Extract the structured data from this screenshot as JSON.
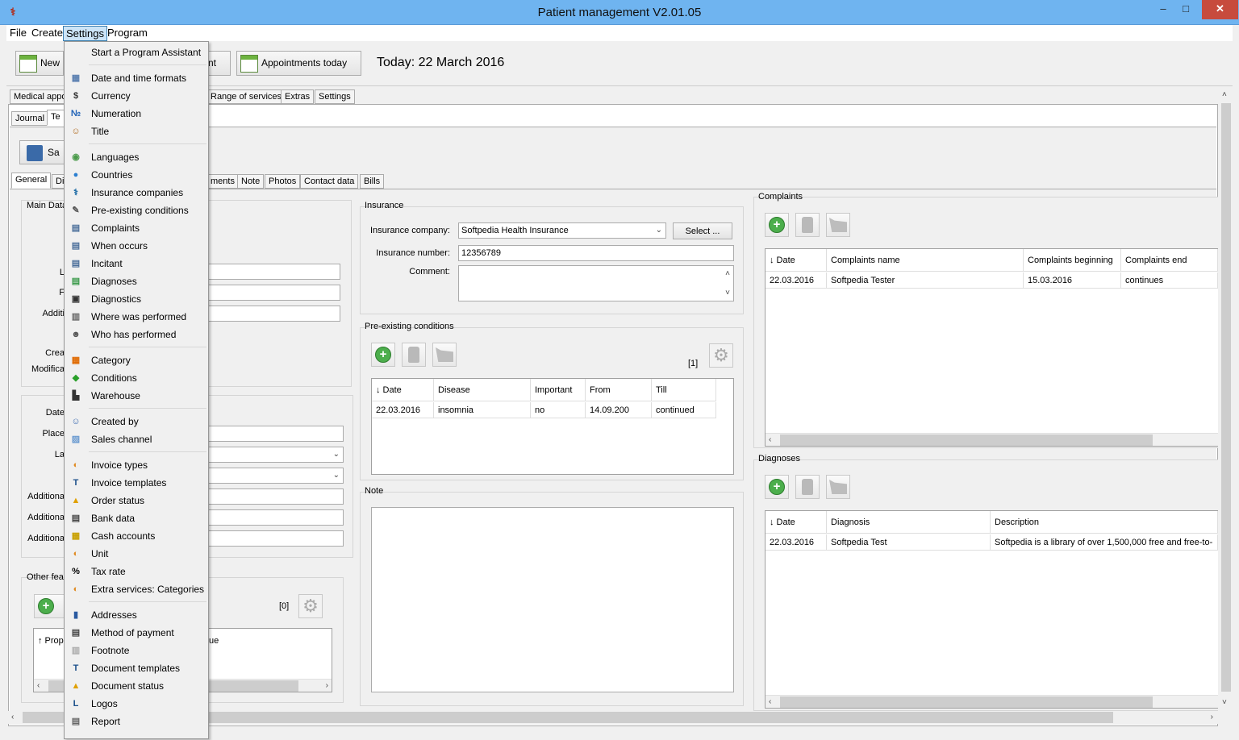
{
  "window": {
    "title": "Patient management V2.01.05",
    "min": "–",
    "max": "□",
    "close": "✕"
  },
  "menubar": [
    "File",
    "Create",
    "Settings",
    "Program"
  ],
  "toolbar": {
    "new_label": "New",
    "appointment_label": "nt",
    "appointments_today_label": "Appointments today",
    "today_text": "Today: 22 March 2016"
  },
  "main_tabs": [
    "Medical appo",
    "Range of services",
    "Extras",
    "Settings"
  ],
  "sub_tabs": [
    "Journal",
    "Te"
  ],
  "save_label": "Sa",
  "detail_tabs": [
    "General",
    "Di",
    "ments",
    "Note",
    "Photos",
    "Contact data",
    "Bills"
  ],
  "left_panel": {
    "main_data_title": "Main Data",
    "labels": [
      "L",
      "F",
      "Additi",
      "Crea",
      "Modifica"
    ],
    "group2_labels": [
      "Date",
      "Place",
      "La",
      "Additiona",
      "Additiona",
      "Additiona"
    ],
    "other_title": "Other fea",
    "other_count": "[0]",
    "table_headers": [
      "↑ Prop",
      "ue"
    ]
  },
  "insurance": {
    "title": "Insurance",
    "company_label": "Insurance company:",
    "company_value": "Softpedia Health Insurance",
    "select_label": "Select ...",
    "number_label": "Insurance number:",
    "number_value": "12356789",
    "comment_label": "Comment:"
  },
  "preexisting": {
    "title": "Pre-existing conditions",
    "count": "[1]",
    "headers": [
      "↓ Date",
      "Disease",
      "Important",
      "From",
      "Till"
    ],
    "rows": [
      [
        "22.03.2016",
        "insomnia",
        "no",
        "14.09.200",
        "continued"
      ]
    ]
  },
  "note": {
    "title": "Note"
  },
  "complaints": {
    "title": "Complaints",
    "headers": [
      "↓ Date",
      "Complaints name",
      "Complaints beginning",
      "Complaints end"
    ],
    "rows": [
      [
        "22.03.2016",
        "Softpedia Tester",
        "15.03.2016",
        "continues"
      ]
    ]
  },
  "diagnoses": {
    "title": "Diagnoses",
    "headers": [
      "↓ Date",
      "Diagnosis",
      "Description"
    ],
    "rows": [
      [
        "22.03.2016",
        "Softpedia Test",
        "Softpedia is a library of over 1,500,000 free and free-to-"
      ]
    ]
  },
  "settings_menu": {
    "items": [
      {
        "label": "Start a Program Assistant",
        "icon": ""
      },
      {
        "label": "Date and time formats",
        "icon": "calendar-icon"
      },
      {
        "label": "Currency",
        "icon": "currency-icon"
      },
      {
        "label": "Numeration",
        "icon": "numero-icon"
      },
      {
        "label": "Title",
        "icon": "person-icon"
      },
      {
        "label": "Languages",
        "icon": "languages-icon"
      },
      {
        "label": "Countries",
        "icon": "globe-icon"
      },
      {
        "label": "Insurance companies",
        "icon": "caduceus-icon"
      },
      {
        "label": "Pre-existing conditions",
        "icon": "pencil-icon"
      },
      {
        "label": "Complaints",
        "icon": "clipboard-icon"
      },
      {
        "label": "When occurs",
        "icon": "clipboard-icon"
      },
      {
        "label": "Incitant",
        "icon": "clipboard-icon"
      },
      {
        "label": "Diagnoses",
        "icon": "diagnoses-icon"
      },
      {
        "label": "Diagnostics",
        "icon": "monitor-icon"
      },
      {
        "label": "Where was performed",
        "icon": "building-icon"
      },
      {
        "label": "Who has performed",
        "icon": "doctor-icon"
      },
      {
        "label": "Category",
        "icon": "category-icon"
      },
      {
        "label": "Conditions",
        "icon": "conditions-icon"
      },
      {
        "label": "Warehouse",
        "icon": "warehouse-icon"
      },
      {
        "label": "Created by",
        "icon": "users-icon"
      },
      {
        "label": "Sales channel",
        "icon": "chart-icon"
      },
      {
        "label": "Invoice types",
        "icon": "invoice-icon"
      },
      {
        "label": "Invoice templates",
        "icon": "template-icon"
      },
      {
        "label": "Order status",
        "icon": "warning-icon"
      },
      {
        "label": "Bank data",
        "icon": "bank-icon"
      },
      {
        "label": "Cash accounts",
        "icon": "cash-icon"
      },
      {
        "label": "Unit",
        "icon": "unit-icon"
      },
      {
        "label": "Tax rate",
        "icon": "percent-icon"
      },
      {
        "label": "Extra services: Categories",
        "icon": "extras-icon"
      },
      {
        "label": "Addresses",
        "icon": "address-book-icon"
      },
      {
        "label": "Method of payment",
        "icon": "payment-icon"
      },
      {
        "label": "Footnote",
        "icon": "footnote-icon"
      },
      {
        "label": "Document templates",
        "icon": "template-icon"
      },
      {
        "label": "Document status",
        "icon": "warning-icon"
      },
      {
        "label": "Logos",
        "icon": "logo-icon"
      },
      {
        "label": "Report",
        "icon": "report-icon"
      }
    ]
  }
}
